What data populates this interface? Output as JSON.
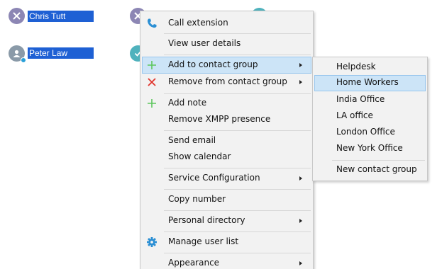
{
  "contacts": [
    {
      "name": "Chris Tutt"
    },
    {
      "name": "Peter Law"
    }
  ],
  "menu": {
    "items": [
      {
        "label": "Call extension",
        "icon": "phone-icon"
      },
      {
        "label": "View user details"
      },
      {
        "label": "Add to contact group",
        "icon": "plus-icon",
        "submenu": true,
        "highlighted": true
      },
      {
        "label": "Remove from contact group",
        "icon": "remove-icon",
        "submenu": true
      },
      {
        "label": "Add note",
        "icon": "plus-icon"
      },
      {
        "label": "Remove XMPP presence"
      },
      {
        "label": "Send email"
      },
      {
        "label": "Show calendar"
      },
      {
        "label": "Service Configuration",
        "submenu": true
      },
      {
        "label": "Copy number"
      },
      {
        "label": "Personal directory",
        "submenu": true
      },
      {
        "label": "Manage user list",
        "icon": "gear-icon"
      },
      {
        "label": "Appearance",
        "submenu": true
      }
    ]
  },
  "submenu": {
    "items": [
      {
        "label": "Helpdesk"
      },
      {
        "label": "Home Workers",
        "highlighted": true
      },
      {
        "label": "India Office"
      },
      {
        "label": "LA office"
      },
      {
        "label": "London Office"
      },
      {
        "label": "New York Office"
      },
      {
        "label": "New contact group"
      }
    ]
  },
  "colors": {
    "selection": "#1e60d4",
    "menu_background": "#f2f2f2",
    "highlight": "#cce4f7",
    "plus_icon": "#5cc65c",
    "remove_icon": "#e0342c",
    "phone_icon": "#2b8fd4",
    "gear_icon": "#2b8fd4"
  }
}
